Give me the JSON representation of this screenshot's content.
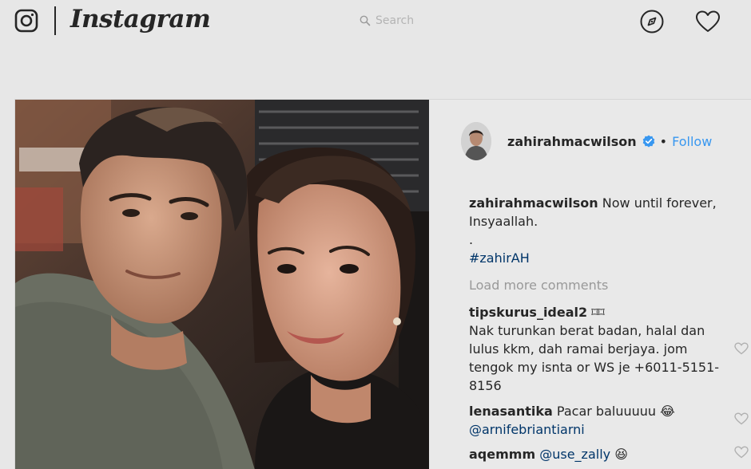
{
  "header": {
    "brand": "Instagram",
    "search_placeholder": "Search"
  },
  "post": {
    "owner": {
      "username": "zahirahmacwilson",
      "separator": "•",
      "follow_label": "Follow"
    },
    "caption": {
      "username": "zahirahmacwilson",
      "line1": "Now until forever,",
      "line2": "Insyaallah.",
      "line3": ".",
      "hashtag": "#zahirAH"
    },
    "load_more_label": "Load more comments",
    "comments": [
      {
        "username": "tipskurus_ideal2",
        "emoji": "⌑⌑",
        "lines": [
          "Nak turunkan berat badan, halal dan",
          "lulus kkm, dah ramai berjaya. jom",
          "tengok my isnta or WS je +6011-5151-",
          "8156"
        ]
      },
      {
        "username": "lenasantika",
        "text": "Pacar baluuuuu",
        "emoji": "😂",
        "mention": "@arnifebriantiarni"
      },
      {
        "username": "aqemmm",
        "mention": "@use_zally",
        "emoji": "😆"
      }
    ]
  },
  "colors": {
    "background": "#e7e7e7",
    "link_blue": "#3897f0",
    "hashtag_navy": "#003569",
    "muted_gray": "#999999",
    "verified_blue": "#3897f0"
  }
}
